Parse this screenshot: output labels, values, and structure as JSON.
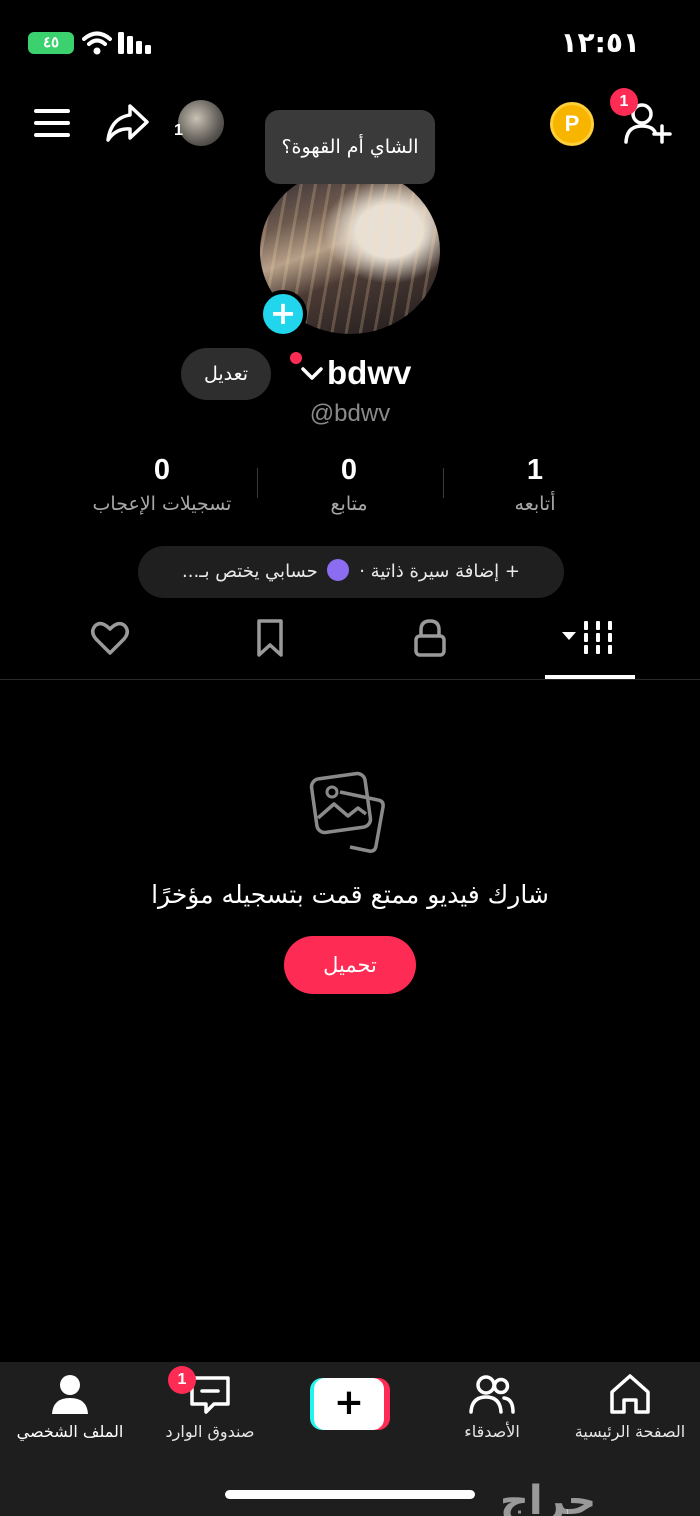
{
  "status_bar": {
    "time": "١٢:٥١",
    "battery": "٤٥"
  },
  "header": {
    "mini_avatar_count": "1",
    "coin_label": "P",
    "add_friends_badge": "1",
    "tooltip": "الشاي أم القهوة؟"
  },
  "profile": {
    "edit_label": "تعديل",
    "display_name": "bdwv",
    "handle": "@bdwv",
    "stats": {
      "following": {
        "value": "1",
        "label": "أتابعه"
      },
      "followers": {
        "value": "0",
        "label": "متابع"
      },
      "likes": {
        "value": "0",
        "label": "تسجيلات الإعجاب"
      }
    },
    "bio_add": "+ إضافة سيرة ذاتية",
    "bio_separator": "·",
    "bio_account": "حسابي يختص بـ..."
  },
  "tabs": [
    "videos",
    "private",
    "saved",
    "liked"
  ],
  "empty_state": {
    "message": "شارك فيديو ممتع قمت بتسجيله مؤخرًا",
    "upload_label": "تحميل"
  },
  "bottom_nav": {
    "home": "الصفحة الرئيسية",
    "friends": "الأصدقاء",
    "create": "+",
    "inbox": "صندوق الوارد",
    "inbox_badge": "1",
    "profile": "الملف الشخصي"
  },
  "watermark": "حراج",
  "colors": {
    "accent": "#fe2c55",
    "cyan": "#25f4ee",
    "background": "#000000",
    "coin": "#f7b500"
  }
}
